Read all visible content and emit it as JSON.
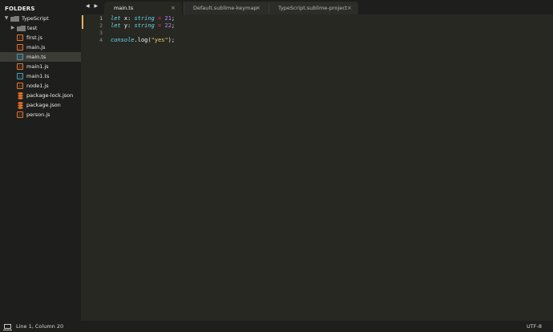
{
  "sidebar": {
    "title": "FOLDERS",
    "root": {
      "label": "TypeScript",
      "expanded": true
    },
    "items": [
      {
        "label": "test",
        "kind": "folder",
        "icon": "folder-icon",
        "expanded": false
      },
      {
        "label": "first.js",
        "kind": "js",
        "icon": "js-file-icon"
      },
      {
        "label": "main.js",
        "kind": "js",
        "icon": "js-file-icon"
      },
      {
        "label": "main.ts",
        "kind": "ts",
        "icon": "ts-file-icon",
        "selected": true
      },
      {
        "label": "main1.js",
        "kind": "js",
        "icon": "js-file-icon"
      },
      {
        "label": "main1.ts",
        "kind": "ts",
        "icon": "ts-file-icon"
      },
      {
        "label": "node1.js",
        "kind": "js",
        "icon": "js-file-icon"
      },
      {
        "label": "package-lock.json",
        "kind": "json",
        "icon": "json-file-icon"
      },
      {
        "label": "package.json",
        "kind": "json",
        "icon": "json-file-icon"
      },
      {
        "label": "person.js",
        "kind": "js",
        "icon": "js-file-icon"
      }
    ]
  },
  "tabbar": {
    "nav_arrows": "◀ ▶",
    "tabs": [
      {
        "label": "main.ts",
        "close": "×",
        "active": true
      },
      {
        "label": "Default.sublime-keymap",
        "close": "×",
        "active": false
      },
      {
        "label": "TypeScript.sublime-project",
        "close": "×",
        "active": false
      }
    ]
  },
  "editor": {
    "line_numbers": [
      "1",
      "2",
      "3",
      "4"
    ],
    "lines": [
      [
        {
          "t": "let",
          "c": "kw"
        },
        {
          "t": " x",
          "c": "plain"
        },
        {
          "t": ":",
          "c": "plain"
        },
        {
          "t": " string",
          "c": "type"
        },
        {
          "t": " =",
          "c": "op"
        },
        {
          "t": " 21",
          "c": "num"
        },
        {
          "t": ";",
          "c": "plain"
        }
      ],
      [
        {
          "t": "let",
          "c": "kw"
        },
        {
          "t": " y",
          "c": "plain"
        },
        {
          "t": ":",
          "c": "plain"
        },
        {
          "t": " string",
          "c": "type"
        },
        {
          "t": " =",
          "c": "op"
        },
        {
          "t": " 22",
          "c": "num"
        },
        {
          "t": ";",
          "c": "plain"
        }
      ],
      [],
      [
        {
          "t": "console",
          "c": "obj"
        },
        {
          "t": ".log(",
          "c": "plain"
        },
        {
          "t": "\"yes\"",
          "c": "str"
        },
        {
          "t": ");",
          "c": "plain"
        }
      ]
    ]
  },
  "statusbar": {
    "position": "Line 1, Column 20",
    "encoding": "UTF-8"
  },
  "colors": {
    "editor_bg": "#272822",
    "sidebar_bg": "#1e1f1c",
    "keyword": "#66d9ef",
    "number": "#ae81ff",
    "operator": "#f92672",
    "string": "#e6db74",
    "modified_marker": "#e6b05a",
    "js_icon": "#e8732c",
    "ts_icon": "#4f9fb8"
  }
}
